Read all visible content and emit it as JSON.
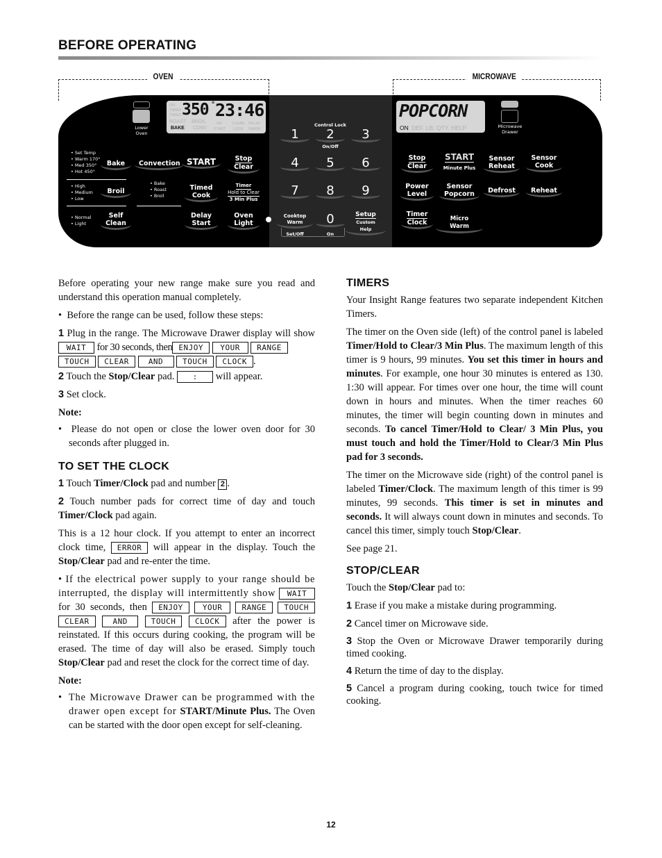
{
  "header": {
    "title": "BEFORE OPERATING"
  },
  "panel": {
    "oven_label": "OVEN",
    "microwave_label": "MICROWAVE",
    "oven_display": {
      "temp": "350",
      "degree": "°",
      "time": "23:46",
      "indicators_left": [
        "ON",
        "TIMER",
        "TIMED"
      ],
      "mode_top": [
        "ROAST",
        "BROIL"
      ],
      "mode_bottom_active": "BAKE",
      "mode_bottom": [
        "CONV"
      ],
      "status_top": [
        "HR",
        "CLEAN",
        "DELAY"
      ],
      "status_bottom": [
        "START",
        "LOCK",
        "WARM"
      ]
    },
    "lower_oven_label": "Lower Oven",
    "oven_pads": {
      "bake": "Bake",
      "bake_options": [
        "• Set Temp",
        "• Warm 170°",
        "• Med 350°",
        "• Hot 450°"
      ],
      "convection": "Convection",
      "start": "START",
      "stop": "Stop",
      "clear": "Clear",
      "broil": "Broil",
      "broil_options": [
        "• High",
        "• Medium",
        "• Low"
      ],
      "conv_options": [
        "• Bake",
        "• Roast",
        "• Broil"
      ],
      "timed": "Timed",
      "cook": "Cook",
      "timer": "Timer",
      "hold_to_clear": "Hold to Clear",
      "three_min_plus": "3 Min Plus",
      "self": "Self",
      "clean": "Clean",
      "self_clean_options": [
        "• Normal",
        "• Light"
      ],
      "delay": "Delay",
      "delay_start": "Start",
      "oven": "Oven",
      "light": "Light"
    },
    "keypad": {
      "control_lock": "Control Lock",
      "on_off": "On/Off",
      "digits": [
        "1",
        "2",
        "3",
        "4",
        "5",
        "6",
        "7",
        "8",
        "9",
        "0"
      ],
      "cooktop": "Cooktop",
      "warm": "Warm",
      "set_off": "Set/Off",
      "on": "On",
      "setup": "Setup",
      "custom_help": "Custom Help"
    },
    "microwave_display": {
      "text": "POPCORN",
      "on": "ON",
      "dim": "DEF. LB. QTY. HELP"
    },
    "microwave_drawer_label": "Microwave Drawer",
    "microwave_pads": {
      "stop": "Stop",
      "clear": "Clear",
      "start": "START",
      "minute_plus": "Minute Plus",
      "sensor_reheat_1": "Sensor",
      "sensor_reheat_2": "Reheat",
      "sensor_cook_1": "Sensor",
      "sensor_cook_2": "Cook",
      "power": "Power",
      "level": "Level",
      "sensor_popcorn_1": "Sensor",
      "sensor_popcorn_2": "Popcorn",
      "defrost": "Defrost",
      "reheat": "Reheat",
      "timer": "Timer",
      "clock": "Clock",
      "micro_warm": "Micro Warm"
    }
  },
  "left_column": {
    "intro": "Before operating your new range make sure you read and understand this operation manual completely.",
    "bullet1": "Before the range can be used, follow these steps:",
    "step1_num": "1",
    "step1_a": "Plug in the range. The Microwave Drawer display will show",
    "step1_b": "for 30 seconds, then",
    "display_words": [
      "WAIT",
      "ENJOY",
      "YOUR",
      "RANGE",
      "TOUCH",
      "CLEAR",
      "AND",
      "TOUCH",
      "CLOCK"
    ],
    "step2_num": "2",
    "step2_a": "Touch the",
    "step2_bold": "Stop/Clear",
    "step2_b": "pad.",
    "step2_box": ":",
    "step2_c": "will appear.",
    "step3_num": "3",
    "step3": "Set clock.",
    "note1_label": "Note:",
    "note1": "Please do not open or close the lower oven door for 30 seconds after plugged in.",
    "clock_title": "TO SET THE CLOCK",
    "clock1_num": "1",
    "clock1_a": "Touch",
    "clock1_bold": "Timer/Clock",
    "clock1_b": "pad and number",
    "clock1_key": "2",
    "clock2_num": "2",
    "clock2_a": "Touch number pads for correct time of day and touch",
    "clock2_bold": "Timer/Clock",
    "clock2_b": "pad again.",
    "error_a": "This is a 12 hour clock. If you attempt to enter an incorrect clock time,",
    "error_box": "ERROR",
    "error_b": "will appear in the display. Touch the",
    "error_bold": "Stop/Clear",
    "error_c": "pad and re-enter the time.",
    "power_a": "If the electrical power supply to your range should be interrupted, the display will intermittently show",
    "power_b": "for 30 seconds, then",
    "power_c": "after the power is reinstated. If this occurs during cooking, the program will be erased. The time of day will also be erased. Simply touch",
    "power_bold": "Stop/Clear",
    "power_d": "pad and reset the clock for the correct time of day.",
    "note2_label": "Note:",
    "note2_a": "The Microwave Drawer can be programmed with the drawer open except for",
    "note2_bold": "START/Minute Plus.",
    "note2_b": "The Oven can be started with the door open except for self-cleaning."
  },
  "right_column": {
    "timers_title": "TIMERS",
    "timers_p1": "Your Insight Range features two separate independent Kitchen Timers.",
    "timers_p2_a": "The timer on the Oven side (left) of the control panel is labeled",
    "timers_p2_bold1": "Timer/Hold to Clear/3 Min Plus",
    "timers_p2_b": ". The maximum length of this timer is 9 hours, 99 minutes.",
    "timers_p2_bold2": "You set this timer in hours and minutes",
    "timers_p2_c": ". For example, one hour 30 minutes is entered as 130. 1:30 will appear. For times over one hour, the time will count down in hours and minutes. When the timer reaches 60 minutes, the timer will begin counting down in minutes and seconds.",
    "timers_p2_bold3": "To cancel Timer/Hold to Clear/ 3 Min Plus, you must touch and hold the Timer/Hold to Clear/3 Min Plus pad for 3 seconds.",
    "timers_p3_a": "The timer on the Microwave side (right) of the control panel is labeled",
    "timers_p3_bold1": "Timer/Clock",
    "timers_p3_b": ". The maximum length of this timer is 99 minutes, 99 seconds.",
    "timers_p3_bold2": "This timer is set in minutes and seconds.",
    "timers_p3_c": "It will always count down in minutes and seconds. To cancel this timer, simply touch",
    "timers_p3_bold3": "Stop/Clear",
    "timers_p3_d": ".",
    "see_page": "See page 21.",
    "stop_title": "STOP/CLEAR",
    "stop_intro_a": "Touch the",
    "stop_intro_bold": "Stop/Clear",
    "stop_intro_b": "pad to:",
    "stop_items": [
      {
        "num": "1",
        "text": "Erase if you make a mistake during programming."
      },
      {
        "num": "2",
        "text": "Cancel timer on Microwave side."
      },
      {
        "num": "3",
        "text": "Stop the Oven or Microwave Drawer temporarily during timed cooking."
      },
      {
        "num": "4",
        "text": "Return the time of day to the display."
      },
      {
        "num": "5",
        "text": "Cancel a program during cooking, touch twice for timed cooking."
      }
    ]
  },
  "footer": {
    "page_number": "12"
  }
}
